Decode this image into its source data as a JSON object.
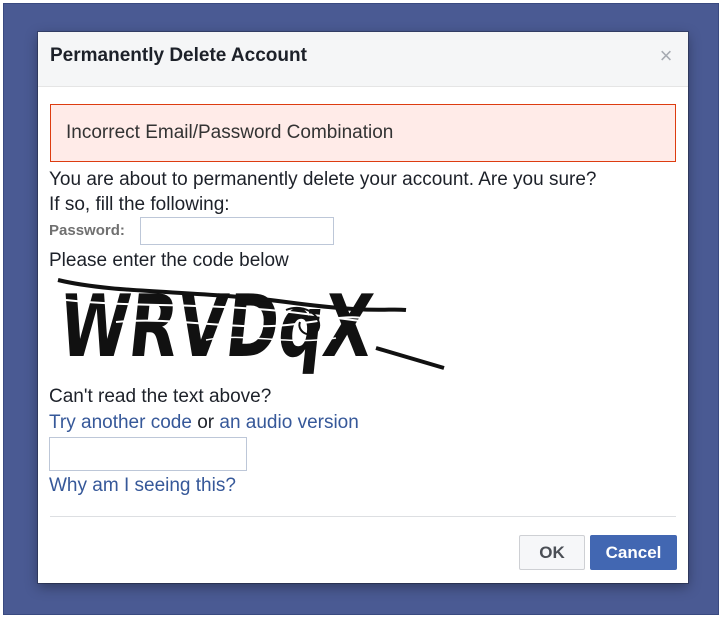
{
  "dialog": {
    "title": "Permanently Delete Account",
    "close_glyph": "×"
  },
  "error": {
    "message": "Incorrect Email/Password Combination"
  },
  "body": {
    "line1": "You are about to permanently delete your account. Are you sure?",
    "line2": "If so, fill the following:",
    "password_label": "Password:",
    "password_value": "",
    "code_prompt": "Please enter the code below",
    "captcha_text": "WRVDqX",
    "cant_read": "Can't read the text above?",
    "try_another": "Try another code",
    "or_text": " or ",
    "audio_version": "an audio version",
    "code_value": "",
    "why_link": "Why am I seeing this?"
  },
  "buttons": {
    "ok": "OK",
    "cancel": "Cancel"
  },
  "colors": {
    "backdrop": "#4a5a93",
    "link": "#365899",
    "primary_button": "#4267b2",
    "error_border": "#dd3c10",
    "error_background": "#ffebe8"
  }
}
